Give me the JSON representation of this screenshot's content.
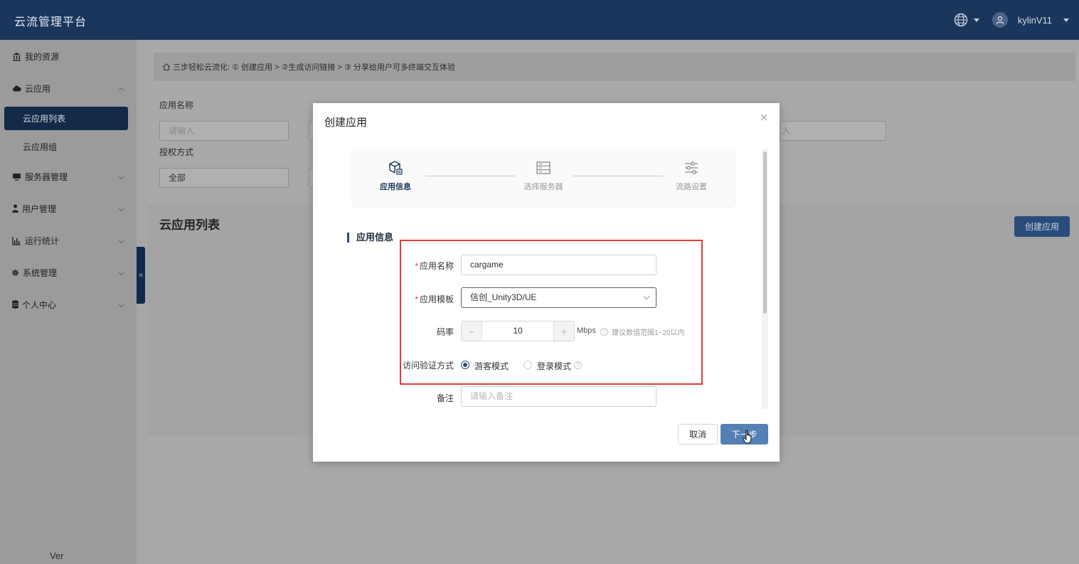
{
  "header": {
    "app_title": "云流管理平台",
    "username": "kylinV11",
    "icons": [
      "globe-icon",
      "user-avatar-icon",
      "chevron-down-icon"
    ]
  },
  "sidebar": {
    "items": [
      {
        "label": "我的资源",
        "icon": "bank-icon"
      },
      {
        "label": "云应用",
        "icon": "cloud-icon"
      },
      {
        "label": "云应用列表",
        "active": true
      },
      {
        "label": "云应用组"
      },
      {
        "label": "服务器管理",
        "icon": "monitor-icon"
      },
      {
        "label": "用户管理",
        "icon": "user-icon"
      },
      {
        "label": "运行统计",
        "icon": "bar-chart-icon"
      },
      {
        "label": "系统管理",
        "icon": "gear-icon"
      },
      {
        "label": "个人中心",
        "icon": "database-icon"
      }
    ],
    "version": "Ver",
    "collapse": "«"
  },
  "page": {
    "breadcrumb": "三步轻松云流化: ① 创建应用 > ②生成访问链接 > ③ 分享给用户可多终端交互体验",
    "filters": {
      "app_name_label": "应用名称",
      "app_name_placeholder": "请输入",
      "auth_label": "授权方式",
      "auth_value": "全部",
      "remark_placeholder_tail": "入"
    },
    "list_title": "云应用列表",
    "create_button": "创建应用"
  },
  "modal": {
    "title": "创建应用",
    "steps": [
      {
        "label": "应用信息",
        "icon": "cube-icon",
        "active": true
      },
      {
        "label": "选择服务器",
        "icon": "server-icon",
        "active": false
      },
      {
        "label": "流路设置",
        "icon": "sliders-icon",
        "active": false
      }
    ],
    "section_title": "应用信息",
    "fields": {
      "app_name": {
        "label": "应用名称",
        "value": "cargame",
        "required": true
      },
      "app_template": {
        "label": "应用模板",
        "value": "信创_Unity3D/UE",
        "required": true
      },
      "bitrate": {
        "label": "码率",
        "value": "10",
        "unit": "Mbps",
        "hint": "建议数值范围1~20以内",
        "minus": "−",
        "plus": "+"
      },
      "access_mode": {
        "label": "访问验证方式",
        "options": [
          "游客模式",
          "登录模式"
        ],
        "selected": "游客模式"
      },
      "remark": {
        "label": "备注",
        "placeholder": "请输入备注"
      }
    },
    "buttons": {
      "cancel": "取消",
      "next": "下一步"
    }
  },
  "colors": {
    "header_bg": "#1b365d",
    "accent": "#2a4c7a",
    "primary_button": "#5580b5",
    "highlight": "#e53935",
    "required": "#e0403a"
  }
}
